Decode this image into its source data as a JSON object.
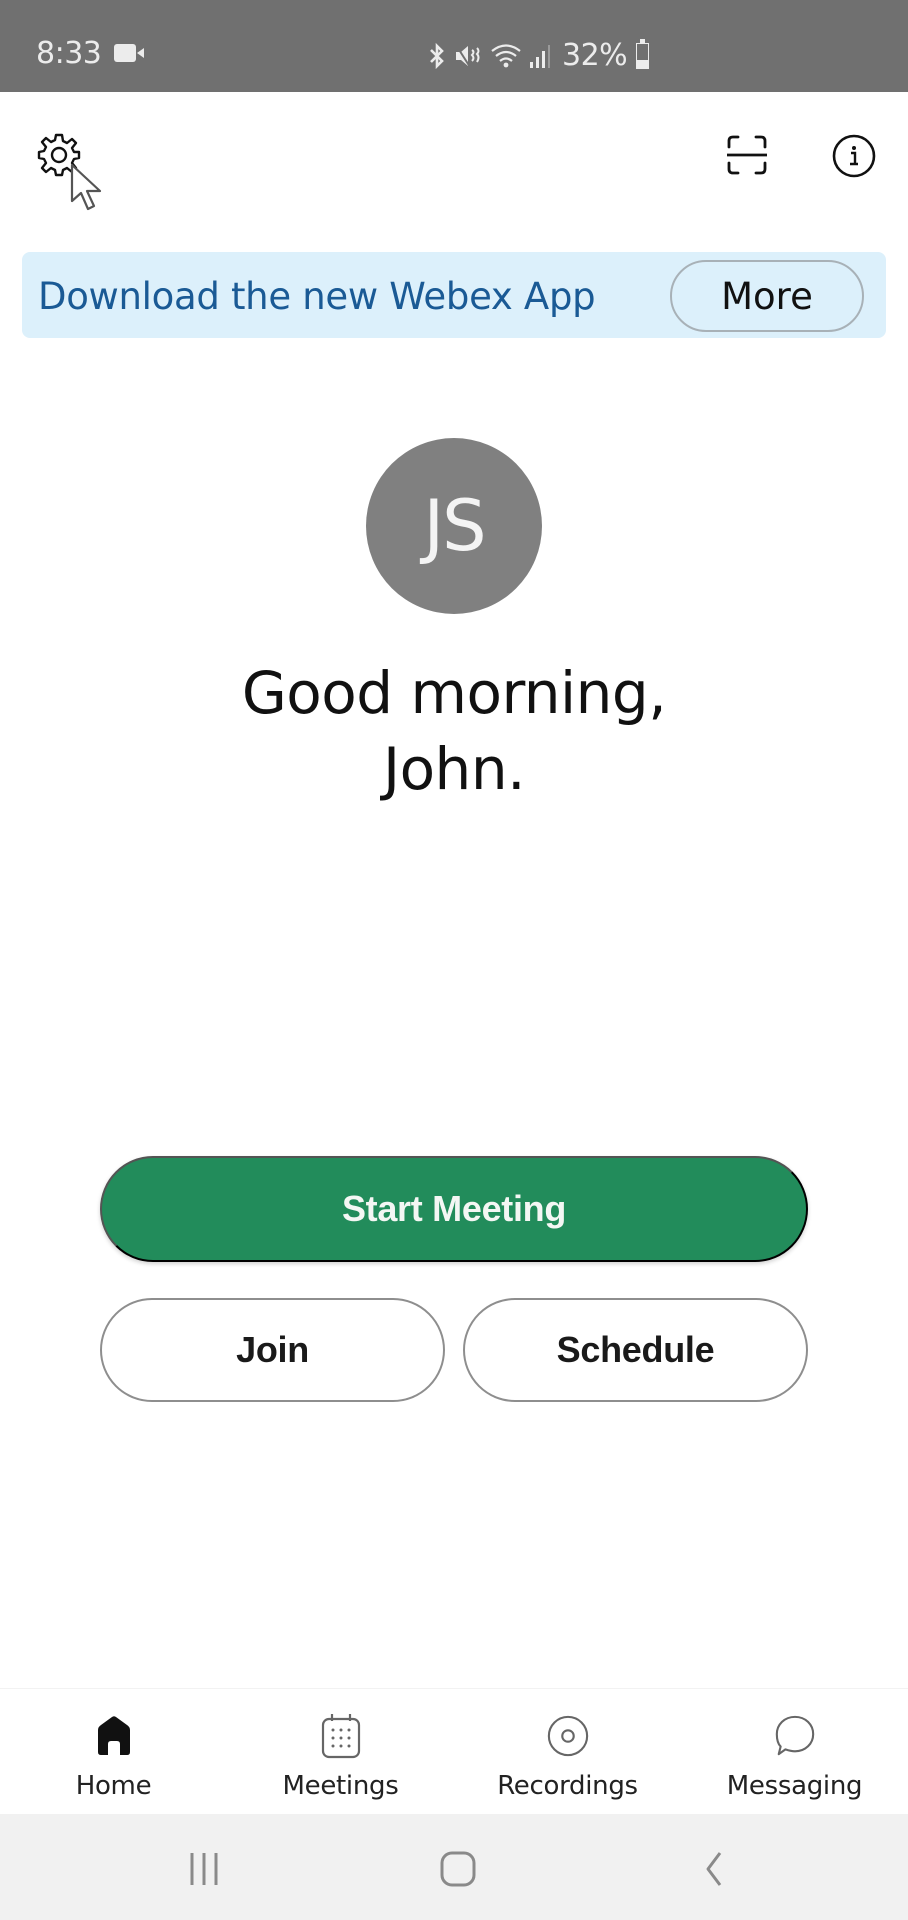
{
  "status_bar": {
    "time": "8:33",
    "battery_text": "32%",
    "battery_level": 0.32,
    "icons": [
      "screen-record-icon",
      "bluetooth-icon",
      "mute-icon",
      "wifi-icon",
      "signal-icon",
      "battery-icon"
    ]
  },
  "toolbar": {
    "settings_icon": "gear-icon",
    "scan_icon": "scan-icon",
    "info_icon": "info-icon"
  },
  "banner": {
    "text": "Download the new Webex App",
    "button_label": "More"
  },
  "profile": {
    "initials": "JS",
    "greeting_line1": "Good morning,",
    "greeting_line2": "John."
  },
  "actions": {
    "start_label": "Start Meeting",
    "join_label": "Join",
    "schedule_label": "Schedule"
  },
  "bottom_nav": {
    "items": [
      {
        "label": "Home",
        "icon": "home-icon",
        "active": true
      },
      {
        "label": "Meetings",
        "icon": "calendar-icon",
        "active": false
      },
      {
        "label": "Recordings",
        "icon": "recording-icon",
        "active": false
      },
      {
        "label": "Messaging",
        "icon": "chat-bubble-icon",
        "active": false
      }
    ]
  },
  "colors": {
    "primary_green": "#228c5b",
    "banner_bg": "#dcf0fb",
    "banner_text": "#1a5a95",
    "avatar_bg": "#808080",
    "status_bar_bg": "#707070"
  }
}
